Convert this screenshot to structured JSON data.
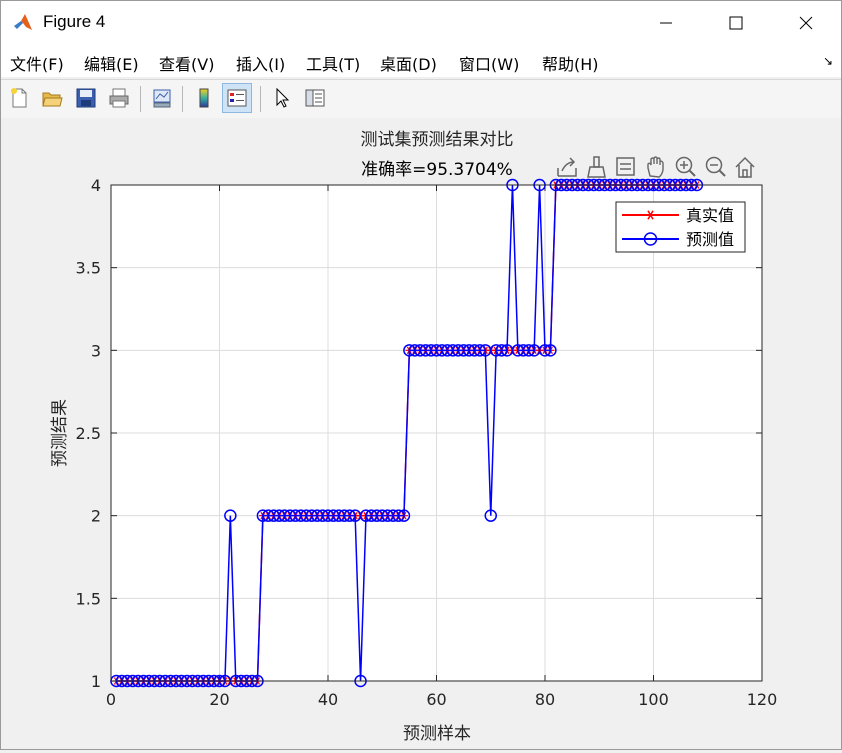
{
  "window": {
    "title": "Figure 4",
    "controls": {
      "minimize": "minimize-icon",
      "maximize": "maximize-icon",
      "close": "close-icon"
    }
  },
  "menubar": {
    "items": [
      {
        "label": "文件(F)"
      },
      {
        "label": "编辑(E)"
      },
      {
        "label": "查看(V)"
      },
      {
        "label": "插入(I)"
      },
      {
        "label": "工具(T)"
      },
      {
        "label": "桌面(D)"
      },
      {
        "label": "窗口(W)"
      },
      {
        "label": "帮助(H)"
      }
    ]
  },
  "toolbar": {
    "buttons": [
      "new-figure-icon",
      "open-file-icon",
      "save-icon",
      "print-icon",
      "link-plot-icon",
      "colorbar-icon",
      "legend-icon",
      "pointer-icon",
      "property-editor-icon"
    ]
  },
  "axes_toolbar": {
    "buttons": [
      "export-icon",
      "brush-icon",
      "datatip-icon",
      "pan-icon",
      "zoom-in-icon",
      "zoom-out-icon",
      "home-icon"
    ]
  },
  "colors": {
    "true_series": "#ff0000",
    "pred_series": "#0000ff",
    "grid": "#dcdcdc"
  },
  "chart_data": {
    "type": "line",
    "title": "测试集预测结果对比",
    "subtitle": "准确率=95.3704%",
    "xlabel": "预测样本",
    "ylabel": "预测结果",
    "xlim": [
      0,
      120
    ],
    "ylim": [
      1,
      4
    ],
    "xticks": [
      0,
      20,
      40,
      60,
      80,
      100,
      120
    ],
    "yticks": [
      1,
      1.5,
      2,
      2.5,
      3,
      3.5,
      4
    ],
    "grid": true,
    "legend_position": "top-right",
    "series": [
      {
        "name": "真实值",
        "marker": "asterisk",
        "color": "#ff0000",
        "values": [
          1,
          1,
          1,
          1,
          1,
          1,
          1,
          1,
          1,
          1,
          1,
          1,
          1,
          1,
          1,
          1,
          1,
          1,
          1,
          1,
          1,
          1,
          1,
          1,
          1,
          1,
          1,
          2,
          2,
          2,
          2,
          2,
          2,
          2,
          2,
          2,
          2,
          2,
          2,
          2,
          2,
          2,
          2,
          2,
          2,
          2,
          2,
          2,
          2,
          2,
          2,
          2,
          2,
          2,
          3,
          3,
          3,
          3,
          3,
          3,
          3,
          3,
          3,
          3,
          3,
          3,
          3,
          3,
          3,
          3,
          3,
          3,
          3,
          3,
          3,
          3,
          3,
          3,
          3,
          3,
          3,
          4,
          4,
          4,
          4,
          4,
          4,
          4,
          4,
          4,
          4,
          4,
          4,
          4,
          4,
          4,
          4,
          4,
          4,
          4,
          4,
          4,
          4,
          4,
          4,
          4,
          4,
          4
        ]
      },
      {
        "name": "预测值",
        "marker": "circle",
        "color": "#0000ff",
        "values": [
          1,
          1,
          1,
          1,
          1,
          1,
          1,
          1,
          1,
          1,
          1,
          1,
          1,
          1,
          1,
          1,
          1,
          1,
          1,
          1,
          1,
          2,
          1,
          1,
          1,
          1,
          1,
          2,
          2,
          2,
          2,
          2,
          2,
          2,
          2,
          2,
          2,
          2,
          2,
          2,
          2,
          2,
          2,
          2,
          2,
          1,
          2,
          2,
          2,
          2,
          2,
          2,
          2,
          2,
          3,
          3,
          3,
          3,
          3,
          3,
          3,
          3,
          3,
          3,
          3,
          3,
          3,
          3,
          3,
          2,
          3,
          3,
          3,
          4,
          3,
          3,
          3,
          3,
          4,
          3,
          3,
          4,
          4,
          4,
          4,
          4,
          4,
          4,
          4,
          4,
          4,
          4,
          4,
          4,
          4,
          4,
          4,
          4,
          4,
          4,
          4,
          4,
          4,
          4,
          4,
          4,
          4,
          4
        ]
      }
    ]
  }
}
